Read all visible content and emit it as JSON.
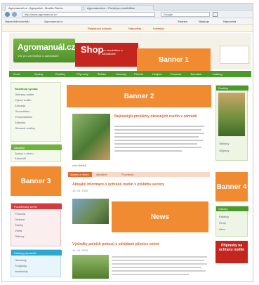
{
  "browser": {
    "tabs": [
      "Agromanuál.cz - Agroportál - Mozilla Firefox",
      "Agromanuál.cz - Portál pro zemědělce"
    ],
    "url": "http://www.agromanual.cz/",
    "search_placeholder": "Google",
    "bookmarks": [
      "Nejnavštěvovanější",
      "Agromanuál.cz"
    ],
    "toolbar": [
      "Stránka",
      "Nástroje",
      "Nápověda"
    ]
  },
  "site": {
    "top_links": [
      "Registrace zdarma",
      "Nápověda",
      "Kontakty"
    ],
    "logo_name": "Agromanuál.cz",
    "logo_tagline": "Vše pro zemědělce a zahrádkáře",
    "shop_label": "Shop",
    "shop_sub": "pro zemědělce a zahrádkáře",
    "nav": [
      "Úvod",
      "Zprávy",
      "Rostliny",
      "Přípravky",
      "Škůdci",
      "Choroby",
      "Plevele",
      "Hnojiva",
      "Poradna",
      "Technika",
      "Katalog"
    ]
  },
  "banners": {
    "banner1": "Banner 1",
    "banner2": "Banner 2",
    "banner3": "Banner 3",
    "banner4": "Banner 4",
    "news": "News"
  },
  "left_sidebar": {
    "items": [
      "Rostlinná výroba",
      "Ochrana rostlin",
      "Výživa rostlin",
      "Zahrada",
      "Ovocnářství",
      "Vinohradnictví",
      "Zelenina",
      "Okrasné rostliny"
    ],
    "box2_head": "Aktuality",
    "box2_items": [
      "Zprávy z oboru",
      "Kalendář"
    ],
    "box3_head": "Poradenský servis",
    "box3_items": [
      "Poradna",
      "Diskuze",
      "Články",
      "Videa",
      "Odkazy"
    ],
    "box4_head": "Katalog přípravků",
    "box4_items": [
      "Herbicidy",
      "Fungicidy",
      "Insekticidy"
    ]
  },
  "main": {
    "feature_title": "Nejčastější problémy okrasných rostlin v zahradě",
    "more": "více článků",
    "tabs": [
      "Zprávy z oboru",
      "Aktuálně",
      "Pozvánky"
    ],
    "news": [
      {
        "title": "Aktuální informace o ochraně rostlin v průběhu sezóny",
        "meta": "15. 04. 2010"
      },
      {
        "title": "Výsledky polních pokusů s odrůdami pšenice ozimé",
        "meta": "14. 04. 2010"
      }
    ]
  },
  "right_sidebar": {
    "head1": "Rostliny",
    "items1": [
      "Obilniny",
      "Olejniny"
    ],
    "head2": "Odkazy",
    "items2": [
      "Katalog",
      "Firmy",
      "Akce"
    ],
    "promo": "Přípravky na ochranu rostlin"
  }
}
